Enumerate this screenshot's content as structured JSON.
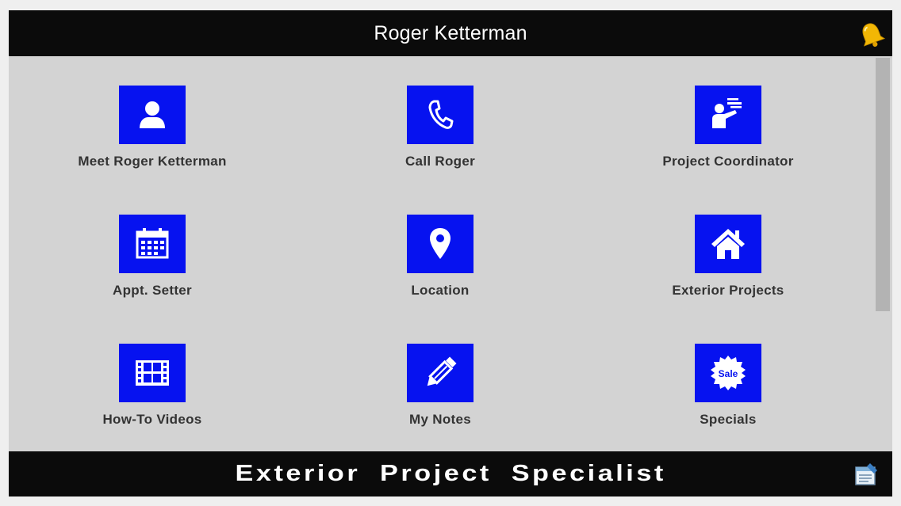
{
  "header": {
    "title": "Roger Ketterman",
    "icon": "bell-icon"
  },
  "tiles": [
    {
      "label": "Meet Roger Ketterman",
      "icon": "user-icon"
    },
    {
      "label": "Call Roger",
      "icon": "phone-icon"
    },
    {
      "label": "Project Coordinator",
      "icon": "presenter-icon"
    },
    {
      "label": "Appt. Setter",
      "icon": "calendar-icon"
    },
    {
      "label": "Location",
      "icon": "map-pin-icon"
    },
    {
      "label": "Exterior Projects",
      "icon": "home-icon"
    },
    {
      "label": "How-To Videos",
      "icon": "film-icon"
    },
    {
      "label": "My Notes",
      "icon": "pencil-icon"
    },
    {
      "label": "Specials",
      "icon": "sale-badge-icon",
      "badge_text": "Sale"
    }
  ],
  "footer": {
    "text": "Exterior Project Specialist",
    "icon": "document-icon"
  },
  "colors": {
    "tile_blue": "#0612f0",
    "bar_black": "#0b0b0b",
    "background": "#d3d3d3",
    "bell_gold": "#f2b705"
  }
}
